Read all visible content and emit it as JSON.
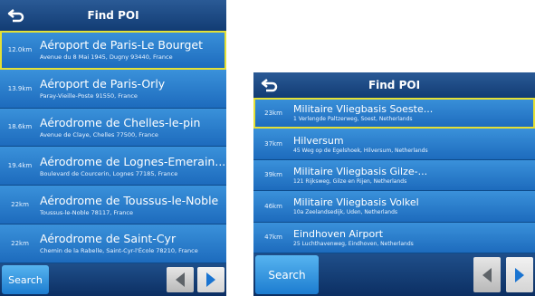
{
  "colors": {
    "background": "#0b4a8e",
    "row": "#2d83d0",
    "selection": "#e4e035",
    "footer": "#173f72",
    "arrow_prev": "#5e6368",
    "arrow_next": "#1a74d1"
  },
  "icons": {
    "back": "back-arrow-icon",
    "prev": "triangle-left-icon",
    "next": "triangle-right-icon"
  },
  "left": {
    "title": "Find POI",
    "search_label": "Search",
    "items": [
      {
        "distance": "12.0km",
        "name": "Aéroport de Paris-Le Bourget",
        "address": "Avenue du 8 Mai 1945, Dugny 93440, France"
      },
      {
        "distance": "13.9km",
        "name": "Aéroport de Paris-Orly",
        "address": "Paray-Vieille-Poste 91550, France"
      },
      {
        "distance": "18.6km",
        "name": "Aérodrome de Chelles-le-pin",
        "address": "Avenue de Claye, Chelles 77500, France"
      },
      {
        "distance": "19.4km",
        "name": "Aérodrome de Lognes-Emerain...",
        "address": "Boulevard de Courcerin, Lognes 77185, France"
      },
      {
        "distance": "22km",
        "name": "Aérodrome de Toussus-le-Noble",
        "address": "Toussus-le-Noble 78117, France"
      },
      {
        "distance": "22km",
        "name": "Aérodrome de Saint-Cyr",
        "address": "Chemin de la Rabelle, Saint-Cyr-l'École 78210, France"
      }
    ]
  },
  "right": {
    "title": "Find POI",
    "search_label": "Search",
    "items": [
      {
        "distance": "23km",
        "name": "Militaire Vliegbasis Soeste...",
        "address": "1 Verlengde Paltzerweg, Soest, Netherlands"
      },
      {
        "distance": "37km",
        "name": "Hilversum",
        "address": "45 Weg op de Egelshoek, Hilversum, Netherlands"
      },
      {
        "distance": "39km",
        "name": "Militaire Vliegbasis Gilze-...",
        "address": "121 Rijksweg, Gilze en Rijen, Netherlands"
      },
      {
        "distance": "46km",
        "name": "Militaire Vliegbasis Volkel",
        "address": "10a Zeelandsedijk, Uden, Netherlands"
      },
      {
        "distance": "47km",
        "name": "Eindhoven Airport",
        "address": "25 Luchthavenweg, Eindhoven, Netherlands"
      }
    ]
  }
}
